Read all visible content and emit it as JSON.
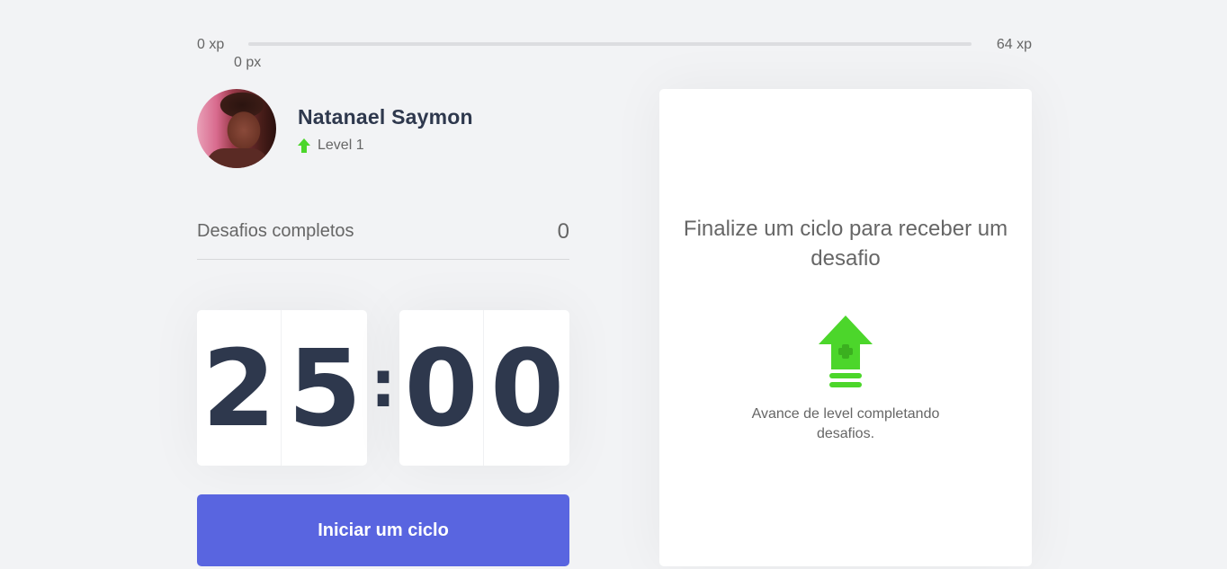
{
  "xp_bar": {
    "min_label": "0 xp",
    "max_label": "64 xp",
    "current_label": "0 px",
    "progress_fraction": 0
  },
  "profile": {
    "name": "Natanael Saymon",
    "level_label": "Level 1",
    "level_icon": "level-up-arrow-icon"
  },
  "challenges": {
    "label": "Desafios completos",
    "count": "0"
  },
  "countdown": {
    "minute_left": "2",
    "minute_right": "5",
    "separator": ":",
    "second_left": "0",
    "second_right": "0"
  },
  "start_button": {
    "label": "Iniciar um ciclo"
  },
  "challenge_box": {
    "title": "Finalize um ciclo para receber um desafio",
    "icon": "level-up-icon",
    "text": "Avance de level completando desafios."
  },
  "colors": {
    "background": "#f2f3f5",
    "title": "#2e384d",
    "text": "#666666",
    "green": "#4cd62b",
    "blue": "#5965e0",
    "white": "#ffffff"
  }
}
